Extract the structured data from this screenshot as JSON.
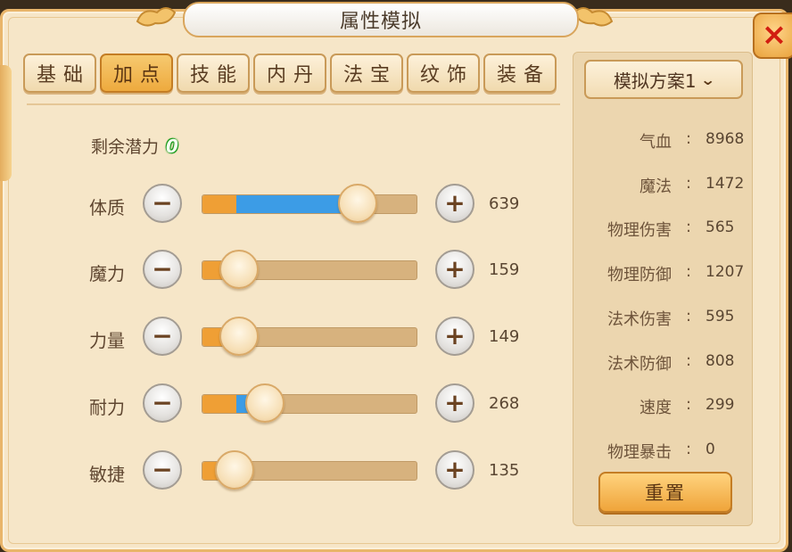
{
  "window": {
    "title": "属性模拟",
    "close_icon": "×"
  },
  "tabs": [
    {
      "label": "基础",
      "active": false
    },
    {
      "label": "加点",
      "active": true
    },
    {
      "label": "技能",
      "active": false
    },
    {
      "label": "内丹",
      "active": false
    },
    {
      "label": "法宝",
      "active": false
    },
    {
      "label": "纹饰",
      "active": false
    },
    {
      "label": "装备",
      "active": false
    }
  ],
  "potential": {
    "label": "剩余潜力",
    "value": "0"
  },
  "attributes": [
    {
      "label": "体质",
      "value": "639",
      "knob_fraction": 0.72,
      "fill_fraction": 0.61
    },
    {
      "label": "魔力",
      "value": "159",
      "knob_fraction": 0.17,
      "fill_fraction": 0.0
    },
    {
      "label": "力量",
      "value": "149",
      "knob_fraction": 0.17,
      "fill_fraction": 0.0
    },
    {
      "label": "耐力",
      "value": "268",
      "knob_fraction": 0.29,
      "fill_fraction": 0.07
    },
    {
      "label": "敏捷",
      "value": "135",
      "knob_fraction": 0.15,
      "fill_fraction": 0.0
    }
  ],
  "controls": {
    "minus_icon": "−",
    "plus_icon": "+"
  },
  "side_panel": {
    "scheme_label": "模拟方案1",
    "scheme_chevron": "⌄",
    "stats": [
      {
        "label": "气血",
        "value": "8968"
      },
      {
        "label": "魔法",
        "value": "1472"
      },
      {
        "label": "物理伤害",
        "value": "565"
      },
      {
        "label": "物理防御",
        "value": "1207"
      },
      {
        "label": "法术伤害",
        "value": "595"
      },
      {
        "label": "法术防御",
        "value": "808"
      },
      {
        "label": "速度",
        "value": "299"
      },
      {
        "label": "物理暴击",
        "value": "0"
      }
    ],
    "reset_label": "重置"
  },
  "colors": {
    "fill_blue": "#3c9ce6",
    "base_orange": "#ef9f35",
    "track": "#d7b27e",
    "potential_green": "#1c9b1e",
    "close_red": "#d21d10"
  }
}
